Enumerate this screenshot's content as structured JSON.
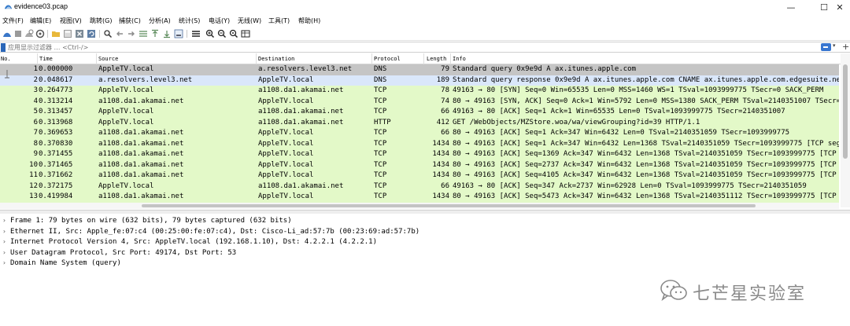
{
  "window": {
    "title": "evidence03.pcap",
    "minimize_glyph": "—",
    "maximize_glyph": "☐",
    "close_glyph": "✕"
  },
  "menu": [
    "文件(F)",
    "编辑(E)",
    "视图(V)",
    "跳转(G)",
    "捕获(C)",
    "分析(A)",
    "统计(S)",
    "电话(Y)",
    "无线(W)",
    "工具(T)",
    "帮助(H)"
  ],
  "toolbar_icons": [
    "start-capture-icon",
    "stop-capture-icon",
    "restart-capture-icon",
    "capture-options-icon",
    "open-file-icon",
    "save-file-icon",
    "close-file-icon",
    "reload-file-icon",
    "find-packet-icon",
    "go-back-icon",
    "go-forward-icon",
    "go-to-packet-icon",
    "go-first-icon",
    "go-last-icon",
    "autoscroll-icon",
    "colorize-icon",
    "zoom-in-icon",
    "zoom-out-icon",
    "zoom-normal-icon",
    "resize-columns-icon"
  ],
  "filter": {
    "placeholder": "应用显示过滤器 … <Ctrl-/>",
    "value": ""
  },
  "columns": {
    "no": "No.",
    "time": "Time",
    "source": "Source",
    "destination": "Destination",
    "protocol": "Protocol",
    "length": "Length",
    "info": "Info"
  },
  "colors": {
    "row_selected": "#c5c5c5",
    "row_dns": "#dae7fa",
    "row_tcp": "#e3f9c8",
    "details_text": "#000000"
  },
  "packets": [
    {
      "no": "1",
      "time": "0.000000",
      "src": "AppleTV.local",
      "dst": "a.resolvers.level3.net",
      "proto": "DNS",
      "len": "79",
      "info": "Standard query 0x9e9d A ax.itunes.apple.com",
      "kind": "selected"
    },
    {
      "no": "2",
      "time": "0.048617",
      "src": "a.resolvers.level3.net",
      "dst": "AppleTV.local",
      "proto": "DNS",
      "len": "189",
      "info": "Standard query response 0x9e9d A ax.itunes.apple.com CNAME ax.itunes.apple.com.edgesuite.ne",
      "kind": "dns"
    },
    {
      "no": "3",
      "time": "0.264773",
      "src": "AppleTV.local",
      "dst": "a1108.da1.akamai.net",
      "proto": "TCP",
      "len": "78",
      "info": "49163 → 80 [SYN] Seq=0 Win=65535 Len=0 MSS=1460 WS=1 TSval=1093999775 TSecr=0 SACK_PERM",
      "kind": "tcp"
    },
    {
      "no": "4",
      "time": "0.313214",
      "src": "a1108.da1.akamai.net",
      "dst": "AppleTV.local",
      "proto": "TCP",
      "len": "74",
      "info": "80 → 49163 [SYN, ACK] Seq=0 Ack=1 Win=5792 Len=0 MSS=1380 SACK_PERM TSval=2140351007 TSecr=",
      "kind": "tcp"
    },
    {
      "no": "5",
      "time": "0.313457",
      "src": "AppleTV.local",
      "dst": "a1108.da1.akamai.net",
      "proto": "TCP",
      "len": "66",
      "info": "49163 → 80 [ACK] Seq=1 Ack=1 Win=65535 Len=0 TSval=1093999775 TSecr=2140351007",
      "kind": "tcp"
    },
    {
      "no": "6",
      "time": "0.313968",
      "src": "AppleTV.local",
      "dst": "a1108.da1.akamai.net",
      "proto": "HTTP",
      "len": "412",
      "info": "GET /WebObjects/MZStore.woa/wa/viewGrouping?id=39 HTTP/1.1",
      "kind": "tcp"
    },
    {
      "no": "7",
      "time": "0.369653",
      "src": "a1108.da1.akamai.net",
      "dst": "AppleTV.local",
      "proto": "TCP",
      "len": "66",
      "info": "80 → 49163 [ACK] Seq=1 Ack=347 Win=6432 Len=0 TSval=2140351059 TSecr=1093999775",
      "kind": "tcp"
    },
    {
      "no": "8",
      "time": "0.370830",
      "src": "a1108.da1.akamai.net",
      "dst": "AppleTV.local",
      "proto": "TCP",
      "len": "1434",
      "info": "80 → 49163 [ACK] Seq=1 Ack=347 Win=6432 Len=1368 TSval=2140351059 TSecr=1093999775 [TCP seg",
      "kind": "tcp"
    },
    {
      "no": "9",
      "time": "0.371455",
      "src": "a1108.da1.akamai.net",
      "dst": "AppleTV.local",
      "proto": "TCP",
      "len": "1434",
      "info": "80 → 49163 [ACK] Seq=1369 Ack=347 Win=6432 Len=1368 TSval=2140351059 TSecr=1093999775 [TCP",
      "kind": "tcp"
    },
    {
      "no": "10",
      "time": "0.371465",
      "src": "a1108.da1.akamai.net",
      "dst": "AppleTV.local",
      "proto": "TCP",
      "len": "1434",
      "info": "80 → 49163 [ACK] Seq=2737 Ack=347 Win=6432 Len=1368 TSval=2140351059 TSecr=1093999775 [TCP",
      "kind": "tcp"
    },
    {
      "no": "11",
      "time": "0.371662",
      "src": "a1108.da1.akamai.net",
      "dst": "AppleTV.local",
      "proto": "TCP",
      "len": "1434",
      "info": "80 → 49163 [ACK] Seq=4105 Ack=347 Win=6432 Len=1368 TSval=2140351059 TSecr=1093999775 [TCP",
      "kind": "tcp"
    },
    {
      "no": "12",
      "time": "0.372175",
      "src": "AppleTV.local",
      "dst": "a1108.da1.akamai.net",
      "proto": "TCP",
      "len": "66",
      "info": "49163 → 80 [ACK] Seq=347 Ack=2737 Win=62928 Len=0 TSval=1093999775 TSecr=2140351059",
      "kind": "tcp"
    },
    {
      "no": "13",
      "time": "0.419984",
      "src": "a1108.da1.akamai.net",
      "dst": "AppleTV.local",
      "proto": "TCP",
      "len": "1434",
      "info": "80 → 49163 [ACK] Seq=5473 Ack=347 Win=6432 Len=1368 TSval=2140351112 TSecr=1093999775 [TCP",
      "kind": "tcp"
    }
  ],
  "details": [
    "Frame 1: 79 bytes on wire (632 bits), 79 bytes captured (632 bits)",
    "Ethernet II, Src: Apple_fe:07:c4 (00:25:00:fe:07:c4), Dst: Cisco-Li_ad:57:7b (00:23:69:ad:57:7b)",
    "Internet Protocol Version 4, Src: AppleTV.local (192.168.1.10), Dst: 4.2.2.1 (4.2.2.1)",
    "User Datagram Protocol, Src Port: 49174, Dst Port: 53",
    "Domain Name System (query)"
  ],
  "detail_arrow": "›",
  "watermark": {
    "text": "七芒星实验室",
    "logo_icon": "wechat-logo-icon"
  }
}
